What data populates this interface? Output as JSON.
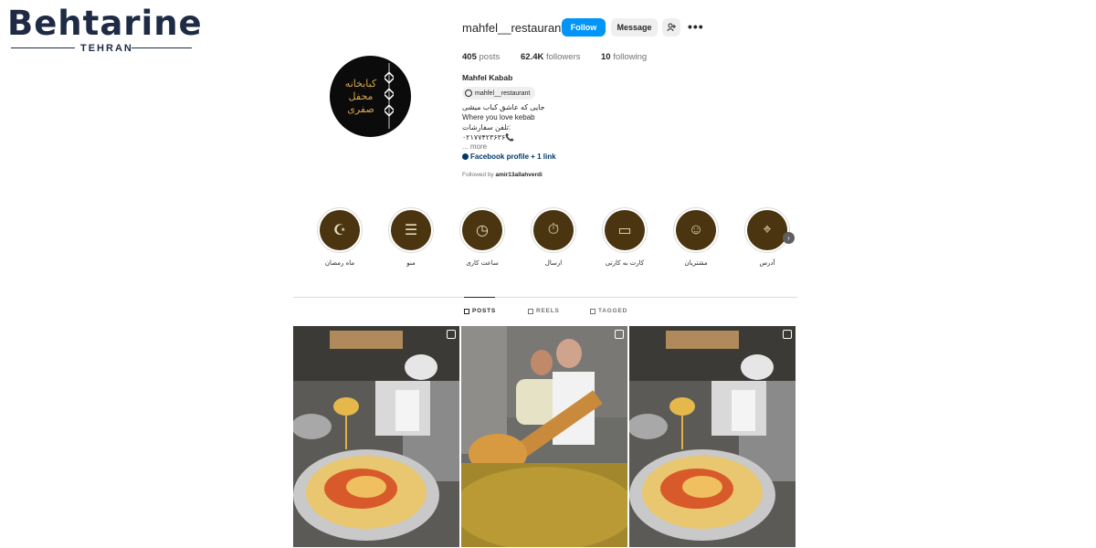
{
  "watermark": {
    "brand": "Behtarine",
    "city": "TEHRAN"
  },
  "profile": {
    "username": "mahfel__restaurant",
    "follow_label": "Follow",
    "message_label": "Message",
    "posts_count": "405",
    "posts_label": "posts",
    "followers_count": "62.4K",
    "followers_label": "followers",
    "following_count": "10",
    "following_label": "following",
    "full_name": "Mahfel Kabab",
    "threads_handle": "mahfel__restaurant",
    "bio_lines": [
      "جایی که عاشق کباب میشی",
      "Where you love kebab",
      "تلفن سفارشات:",
      "۰۲۱۷۷۴۲۳۶۳۶📞"
    ],
    "more_label": "... more",
    "link_label": "Facebook profile + 1 link",
    "followed_by_prefix": "Followed by",
    "followed_by_user": "amir13allahverdi",
    "avatar_text": "کبابخانه محفل صفری"
  },
  "highlights": [
    {
      "label": "ماه رمضان",
      "icon": "ramadan-icon"
    },
    {
      "label": "منو",
      "icon": "menu-icon"
    },
    {
      "label": "ساعت کاری",
      "icon": "clock-icon"
    },
    {
      "label": "ارسال",
      "icon": "delivery-icon"
    },
    {
      "label": "کارت به کارتی",
      "icon": "card-icon"
    },
    {
      "label": "مشتریان",
      "icon": "customers-icon"
    },
    {
      "label": "آدرس",
      "icon": "location-icon"
    }
  ],
  "tabs": [
    {
      "label": "POSTS",
      "active": true
    },
    {
      "label": "REELS",
      "active": false
    },
    {
      "label": "TAGGED",
      "active": false
    }
  ],
  "colors": {
    "accent": "#0095f6",
    "highlight_bg": "#4a3510",
    "logo_gold": "#d4a44a"
  }
}
